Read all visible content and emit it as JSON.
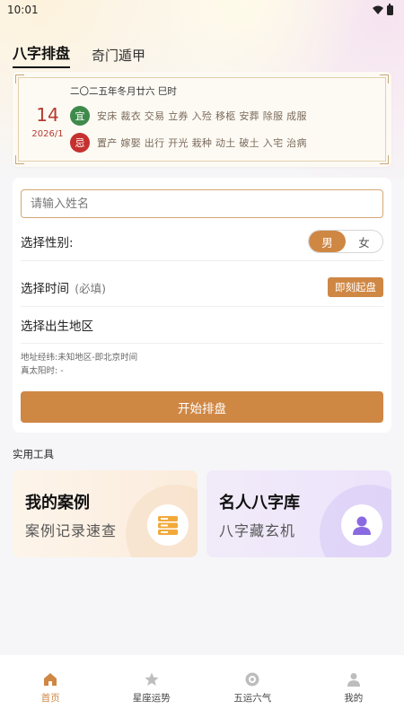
{
  "status_bar": {
    "time": "10:01"
  },
  "tabs": [
    {
      "label": "八字排盘",
      "active": true
    },
    {
      "label": "奇门遁甲",
      "active": false
    }
  ],
  "almanac": {
    "day": "14",
    "year_month": "2026/1",
    "lunar": "二〇二五年冬月廿六 巳时",
    "yi_badge": "宜",
    "yi_text": "安床 裁衣 交易 立券 入殓 移柩 安葬 除服 成服",
    "ji_badge": "忌",
    "ji_text": "置产 嫁娶 出行 开光 栽种 动土 破土 入宅 治病",
    "colors": {
      "yi": "#3f8a4b",
      "ji": "#c5312e",
      "date": "#b53a2f"
    }
  },
  "form": {
    "name_placeholder": "请输入姓名",
    "name_value": "",
    "gender_label": "选择性别:",
    "gender_options": [
      "男",
      "女"
    ],
    "gender_selected": "男",
    "time_label": "选择时间",
    "time_required": "(必填)",
    "instant_button": "即刻起盘",
    "place_label": "选择出生地区",
    "note_address": "地址经纬:未知地区-即北京时间",
    "note_solar": "真太阳时: -",
    "start_button": "开始排盘",
    "accent": "#cf8744"
  },
  "tools": {
    "section_title": "实用工具",
    "items": [
      {
        "title": "我的案例",
        "subtitle": "案例记录速查",
        "icon": "server-stack-icon"
      },
      {
        "title": "名人八字库",
        "subtitle": "八字藏玄机",
        "icon": "person-icon"
      }
    ]
  },
  "bottom_nav": [
    {
      "label": "首页",
      "icon": "home-icon",
      "active": true
    },
    {
      "label": "星座运势",
      "icon": "star-icon",
      "active": false
    },
    {
      "label": "五运六气",
      "icon": "cycle-icon",
      "active": false
    },
    {
      "label": "我的",
      "icon": "user-icon",
      "active": false
    }
  ]
}
